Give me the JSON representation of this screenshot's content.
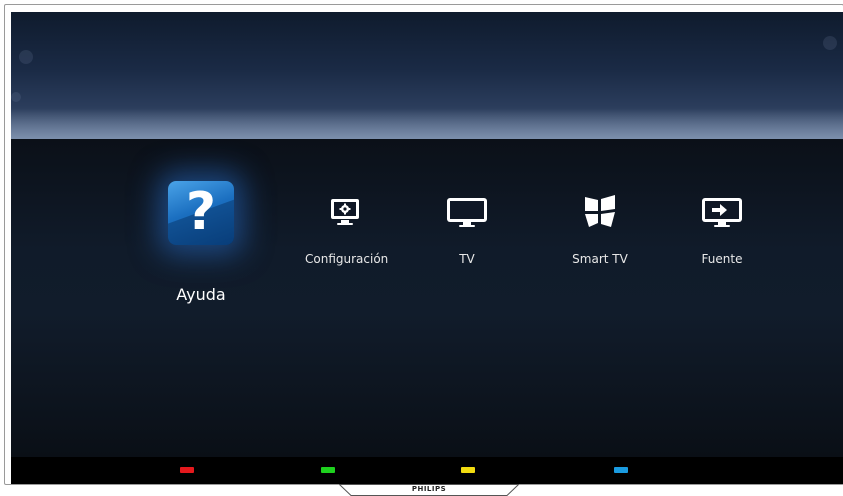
{
  "home_menu": {
    "items": [
      {
        "label": "Ayuda",
        "icon": "help-icon",
        "selected": true
      },
      {
        "label": "Configuración",
        "icon": "settings-icon",
        "selected": false
      },
      {
        "label": "TV",
        "icon": "tv-icon",
        "selected": false
      },
      {
        "label": "Smart TV",
        "icon": "smart-tv-icon",
        "selected": false
      },
      {
        "label": "Fuente",
        "icon": "source-icon",
        "selected": false
      }
    ]
  },
  "help_glyph": "?",
  "color_keys": [
    {
      "name": "red",
      "color": "#e5191d"
    },
    {
      "name": "green",
      "color": "#1ed11e"
    },
    {
      "name": "yellow",
      "color": "#f2dc10"
    },
    {
      "name": "blue",
      "color": "#1a9be0"
    }
  ],
  "brand": "PHILIPS"
}
